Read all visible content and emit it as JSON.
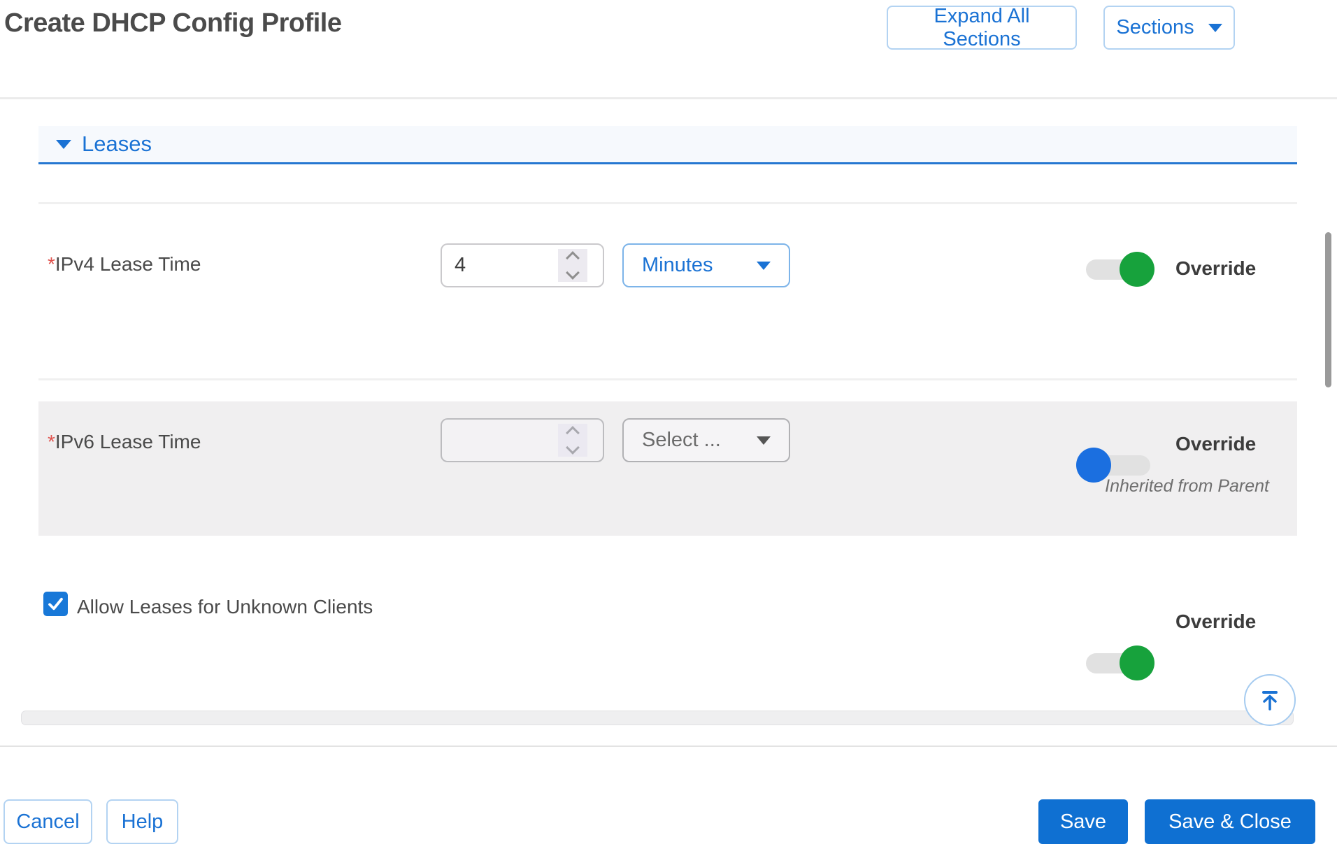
{
  "title": "Create DHCP Config Profile",
  "header_buttons": {
    "expand_all": "Expand All Sections",
    "sections": "Sections"
  },
  "section": {
    "name": "Leases"
  },
  "fields": {
    "ipv4_lease_time": {
      "required_marker": "*",
      "label": "IPv4 Lease Time",
      "value": "4",
      "unit_selected": "Minutes",
      "override": {
        "label": "Override",
        "state": "on"
      }
    },
    "ipv6_lease_time": {
      "required_marker": "*",
      "label": "IPv6 Lease Time",
      "value": "",
      "unit_placeholder": "Select ...",
      "override": {
        "label": "Override",
        "state": "off",
        "note": "Inherited from Parent"
      }
    },
    "allow_unknown_clients": {
      "label": "Allow Leases for Unknown Clients",
      "checked": true,
      "override": {
        "label": "Override",
        "state": "on"
      }
    }
  },
  "footer": {
    "cancel": "Cancel",
    "help": "Help",
    "save": "Save",
    "save_and_close": "Save & Close"
  },
  "colors": {
    "accent_blue": "#1a72d4",
    "primary_button_blue": "#0f70d2",
    "toggle_on_green": "#17a23c",
    "toggle_off_blue": "#1b6fe0",
    "checkbox_blue": "#1878d8",
    "required_red": "#e0524d",
    "section_bar_bg": "#f6f9fd",
    "disabled_panel_bg": "#f0eff0"
  },
  "icons": {
    "sections_button": "chevron-down-icon",
    "leases_header": "triangle-down-icon",
    "unit_dropdowns": "chevron-down-icon",
    "number_stepper": "chevron-up-down-icon",
    "checkbox": "check-icon",
    "scroll_to_top_button": "arrow-up-to-line-icon"
  }
}
